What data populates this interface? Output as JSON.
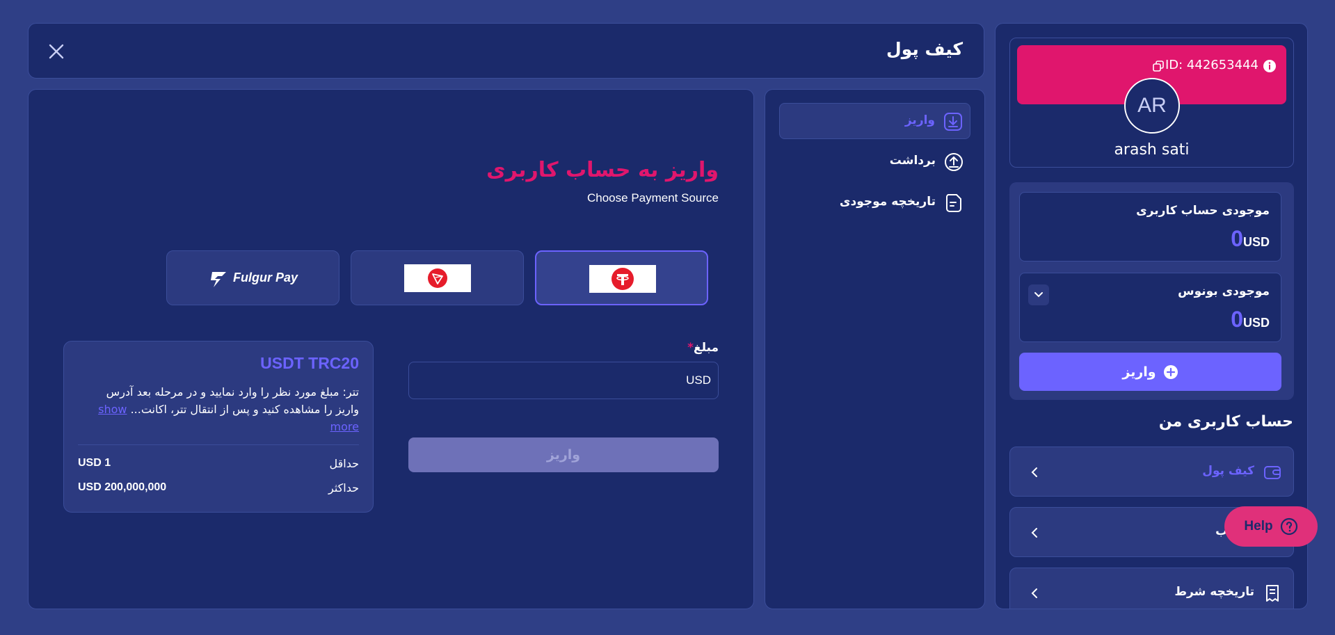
{
  "header": {
    "title": "کیف پول",
    "close_icon": "close-icon"
  },
  "profile": {
    "id_text": "ID: 442653444",
    "avatar_initials": "AR",
    "username": "arash sati",
    "banner_color": "#e0166d"
  },
  "balances": {
    "account_label": "موجودی حساب کاربری",
    "account_amount": "0",
    "account_currency": "USD",
    "bonus_label": "موجودی بونوس",
    "bonus_amount": "0",
    "bonus_currency": "USD",
    "deposit_button": "واریز"
  },
  "my_account": {
    "title": "حساب کاربری من",
    "items": [
      {
        "label": "کیف پول",
        "icon": "wallet-icon",
        "active": true
      },
      {
        "label": "ات حساب",
        "icon": "user-settings-icon",
        "active": false
      },
      {
        "label": "تاریخچه شرط",
        "icon": "receipt-icon",
        "active": false
      }
    ]
  },
  "menu": {
    "items": [
      {
        "label": "واریز",
        "icon": "download-icon",
        "active": true
      },
      {
        "label": "برداشت",
        "icon": "upload-icon",
        "active": false
      },
      {
        "label": "تاریخچه موجودی",
        "icon": "document-icon",
        "active": false
      }
    ]
  },
  "main": {
    "title": "واریز به حساب کاربری",
    "subtitle": "Choose Payment Source",
    "sources": [
      {
        "name": "tether",
        "icon": "tether-icon",
        "selected": true
      },
      {
        "name": "tron",
        "icon": "tron-icon",
        "selected": false
      },
      {
        "name": "Fulgur Pay",
        "icon": "fulgur-pay-icon",
        "selected": false
      }
    ],
    "amount_label": "مبلغ",
    "required_mark": "*",
    "amount_currency": "USD",
    "submit_button": "واریز"
  },
  "info_card": {
    "title": "USDT TRC20",
    "description": "تتر: مبلغ مورد نظر را وارد نمایید و در مرحله بعد آدرس واریز را مشاهده کنید و پس از انتقال تتر، اکانت...",
    "show_more": "show more",
    "min_label": "حداقل",
    "min_value": "USD 1",
    "max_label": "حداکثر",
    "max_value": "USD 200,000,000"
  },
  "help": {
    "label": "Help",
    "icon": "help-icon"
  },
  "colors": {
    "accent": "#6c63ff",
    "brand": "#e0166d",
    "panel": "#1b2a6b",
    "bg": "#2f3f86"
  }
}
